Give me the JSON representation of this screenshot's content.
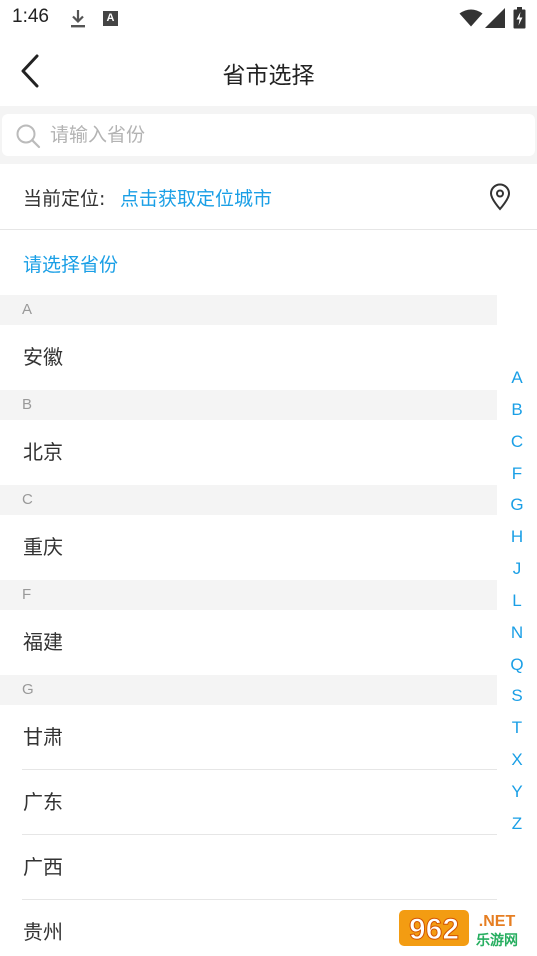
{
  "status_bar": {
    "time": "1:46",
    "icons": [
      "download-icon",
      "a-notification-icon",
      "wifi-icon",
      "signal-icon",
      "battery-icon"
    ],
    "notif_letter": "A"
  },
  "header": {
    "title": "省市选择",
    "back_icon": "chevron-left-icon"
  },
  "search": {
    "placeholder": "请输入省份",
    "value": ""
  },
  "location": {
    "label": "当前定位:",
    "link": "点击获取定位城市",
    "icon": "map-pin-icon"
  },
  "hint": "请选择省份",
  "sections": [
    {
      "letter": "A",
      "items": [
        "安徽"
      ]
    },
    {
      "letter": "B",
      "items": [
        "北京"
      ]
    },
    {
      "letter": "C",
      "items": [
        "重庆"
      ]
    },
    {
      "letter": "F",
      "items": [
        "福建"
      ]
    },
    {
      "letter": "G",
      "items": [
        "甘肃",
        "广东",
        "广西",
        "贵州"
      ]
    }
  ],
  "index_letters": [
    "A",
    "B",
    "C",
    "F",
    "G",
    "H",
    "J",
    "L",
    "N",
    "Q",
    "S",
    "T",
    "X",
    "Y",
    "Z"
  ],
  "watermark": {
    "text_1": "962",
    "text_2": ".NET",
    "text_3": "乐游网"
  },
  "colors": {
    "accent": "#1a9fe6",
    "section_bg": "#f4f4f4",
    "text": "#333333"
  }
}
